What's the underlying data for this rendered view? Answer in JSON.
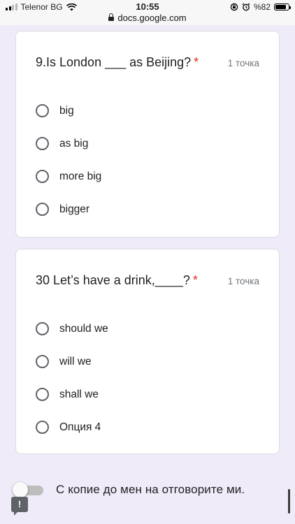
{
  "status_bar": {
    "carrier": "Telenor BG",
    "time": "10:55",
    "url": "docs.google.com",
    "battery_percent_label": "%82",
    "battery_level": 0.82,
    "icons": [
      "signal-icon",
      "wifi-icon",
      "lock-icon",
      "rotation-lock-icon",
      "alarm-icon",
      "battery-icon"
    ]
  },
  "questions": [
    {
      "title": "9.Is London ___ as Beijing?",
      "required_mark": "*",
      "points": "1 точка",
      "options": [
        "big",
        "as big",
        "more big",
        "bigger"
      ]
    },
    {
      "title": "30 Let’s have a drink,____?",
      "required_mark": "*",
      "points": "1 точка",
      "options": [
        "should we",
        "will we",
        "shall we",
        "Опция 4"
      ]
    }
  ],
  "copy_toggle": {
    "label": "С копие до мен на отговорите ми.",
    "checked": false
  },
  "feedback_button": {
    "glyph": "!"
  },
  "colors": {
    "page_background": "#f0ebf8",
    "required_mark": "#d93025",
    "radio_border": "#5f6368",
    "points_text": "#70757a"
  }
}
